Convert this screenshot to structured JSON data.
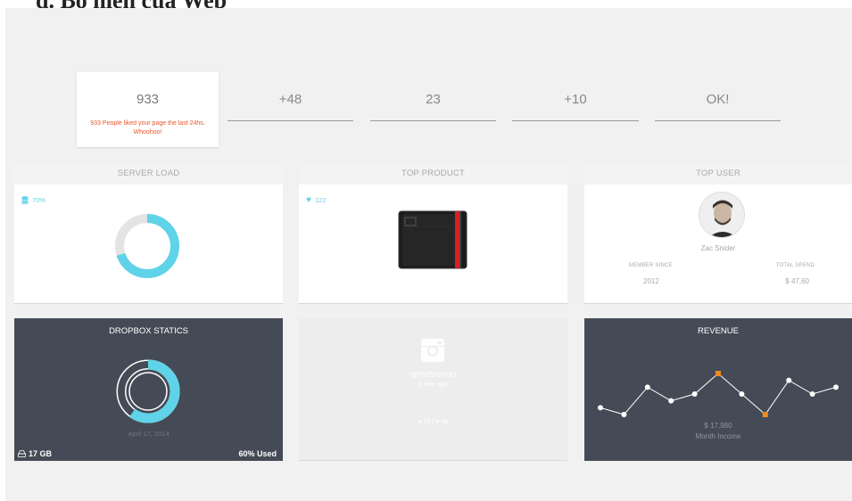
{
  "heading_cut": "d. Bố hiện của Web",
  "stats": [
    {
      "value": "933",
      "note": "933 People liked your page the last 24hs. Whoohoo!"
    },
    {
      "value": "+48"
    },
    {
      "value": "23"
    },
    {
      "value": "+10"
    },
    {
      "value": "OK!"
    }
  ],
  "server_load": {
    "title": "SERVER LOAD",
    "badge": "70%",
    "percent": 70
  },
  "top_product": {
    "title": "TOP PRODUCT",
    "likes": "122"
  },
  "top_user": {
    "title": "TOP USER",
    "name": "Zac Snider",
    "member_since_label": "MEMBER SINCE",
    "member_since": "2012",
    "total_spend_label": "TOTAL SPEND",
    "total_spend": "$ 47,60"
  },
  "dropbox": {
    "title": "DROPBOX STATICS",
    "date": "April 17, 2014",
    "storage": "17 GB",
    "used": "60% Used",
    "percent": 60
  },
  "instagram": {
    "handle": "@THISISYOU",
    "time": "5 min. ago",
    "comments": "18",
    "likes": "49"
  },
  "revenue": {
    "title": "REVENUE",
    "amount": "$ 17,980",
    "caption": "Month Income",
    "chart_data": {
      "type": "line",
      "values": [
        3,
        2,
        6,
        4,
        5,
        8,
        5,
        2,
        7,
        5,
        6
      ],
      "highlight_indices": [
        5,
        7
      ]
    }
  },
  "colors": {
    "accent": "#5fd3e8",
    "orange": "#f08a24",
    "note": "#e8572c",
    "dark_card": "#454b56"
  }
}
